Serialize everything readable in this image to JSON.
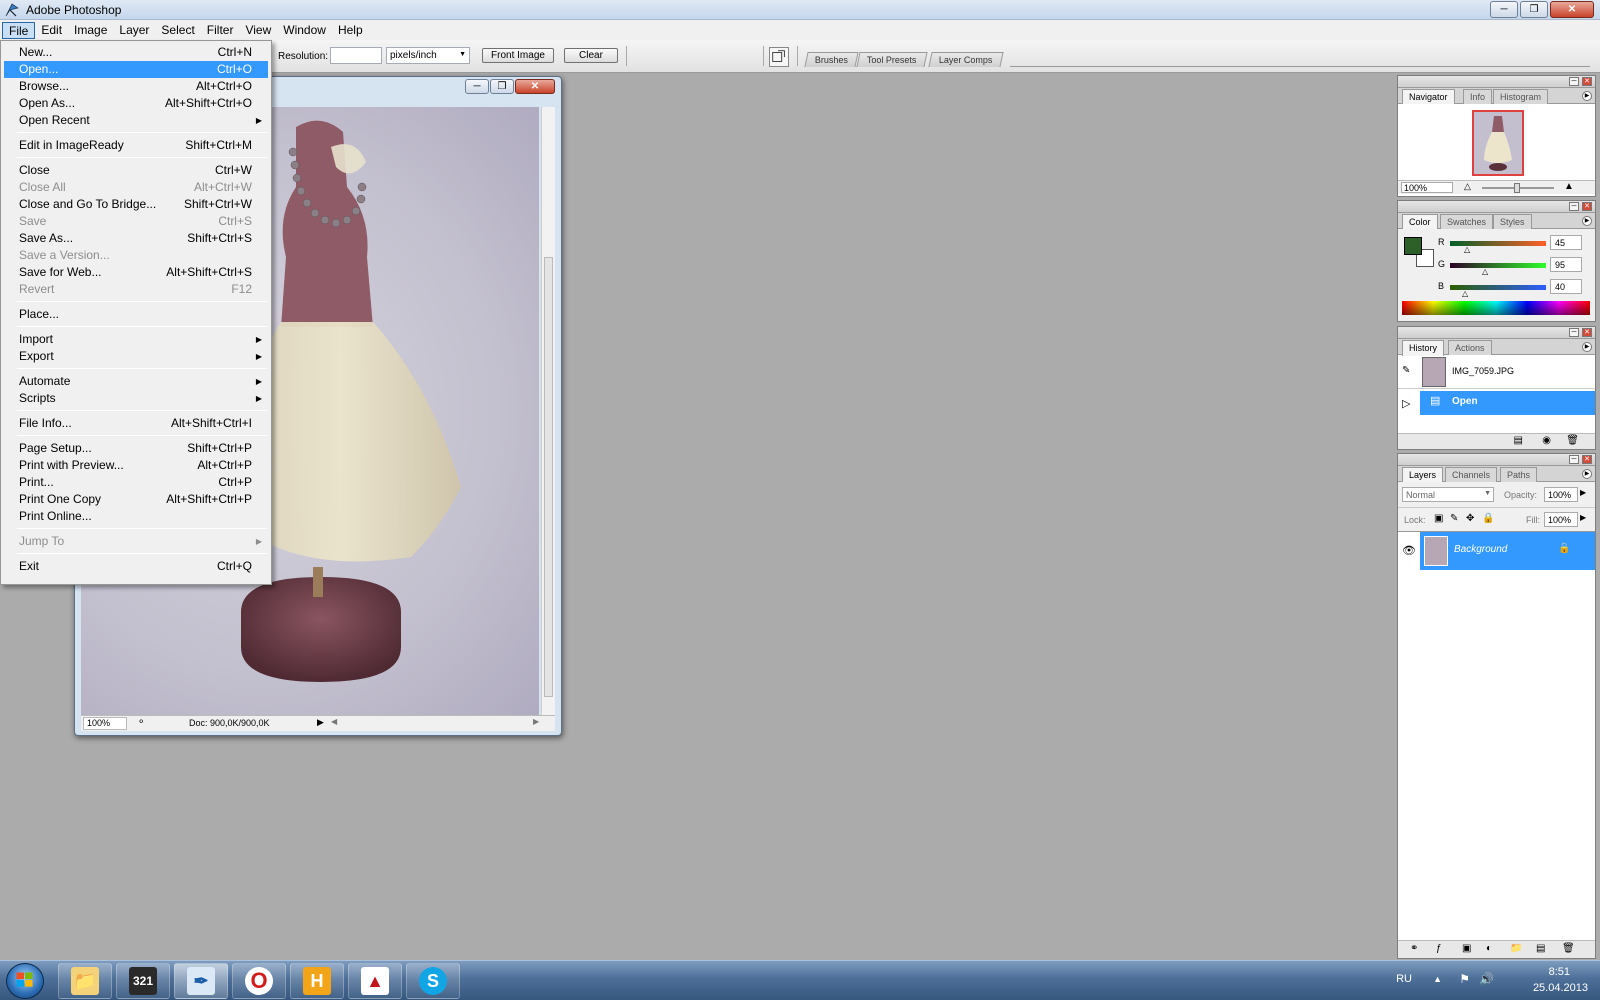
{
  "app": {
    "title": "Adobe Photoshop"
  },
  "menubar": [
    "File",
    "Edit",
    "Image",
    "Layer",
    "Select",
    "Filter",
    "View",
    "Window",
    "Help"
  ],
  "options_bar": {
    "resolution_label": "Resolution:",
    "resolution_value": "",
    "units": "pixels/inch",
    "front_image": "Front Image",
    "clear": "Clear",
    "well_tabs": [
      "Brushes",
      "Tool Presets",
      "Layer Comps"
    ]
  },
  "file_menu": {
    "items": [
      {
        "label": "New...",
        "shortcut": "Ctrl+N"
      },
      {
        "label": "Open...",
        "shortcut": "Ctrl+O"
      },
      {
        "label": "Browse...",
        "shortcut": "Alt+Ctrl+O"
      },
      {
        "label": "Open As...",
        "shortcut": "Alt+Shift+Ctrl+O"
      },
      {
        "label": "Open Recent",
        "shortcut": ""
      },
      {
        "label": "Edit in ImageReady",
        "shortcut": "Shift+Ctrl+M"
      },
      {
        "label": "Close",
        "shortcut": "Ctrl+W"
      },
      {
        "label": "Close All",
        "shortcut": "Alt+Ctrl+W"
      },
      {
        "label": "Close and Go To Bridge...",
        "shortcut": "Shift+Ctrl+W"
      },
      {
        "label": "Save",
        "shortcut": "Ctrl+S"
      },
      {
        "label": "Save As...",
        "shortcut": "Shift+Ctrl+S"
      },
      {
        "label": "Save a Version...",
        "shortcut": ""
      },
      {
        "label": "Save for Web...",
        "shortcut": "Alt+Shift+Ctrl+S"
      },
      {
        "label": "Revert",
        "shortcut": "F12"
      },
      {
        "label": "Place...",
        "shortcut": ""
      },
      {
        "label": "Import",
        "shortcut": ""
      },
      {
        "label": "Export",
        "shortcut": ""
      },
      {
        "label": "Automate",
        "shortcut": ""
      },
      {
        "label": "Scripts",
        "shortcut": ""
      },
      {
        "label": "File Info...",
        "shortcut": "Alt+Shift+Ctrl+I"
      },
      {
        "label": "Page Setup...",
        "shortcut": "Shift+Ctrl+P"
      },
      {
        "label": "Print with Preview...",
        "shortcut": "Alt+Ctrl+P"
      },
      {
        "label": "Print...",
        "shortcut": "Ctrl+P"
      },
      {
        "label": "Print One Copy",
        "shortcut": "Alt+Shift+Ctrl+P"
      },
      {
        "label": "Print Online...",
        "shortcut": ""
      },
      {
        "label": "Jump To",
        "shortcut": ""
      },
      {
        "label": "Exit",
        "shortcut": "Ctrl+Q"
      }
    ]
  },
  "document": {
    "zoom": "100%",
    "doc_info": "Doc: 900,0K/900,0K"
  },
  "navigator": {
    "tabs": [
      "Navigator",
      "Info",
      "Histogram"
    ],
    "zoom": "100%"
  },
  "color_panel": {
    "tabs": [
      "Color",
      "Swatches",
      "Styles"
    ],
    "r_label": "R",
    "g_label": "G",
    "b_label": "B",
    "r": "45",
    "g": "95",
    "b": "40",
    "foreground": "#2d5f28"
  },
  "history_panel": {
    "tabs": [
      "History",
      "Actions"
    ],
    "snapshot": "IMG_7059.JPG",
    "state": "Open"
  },
  "layers_panel": {
    "tabs": [
      "Layers",
      "Channels",
      "Paths"
    ],
    "blend_mode": "Normal",
    "opacity_label": "Opacity:",
    "opacity": "100%",
    "lock_label": "Lock:",
    "fill_label": "Fill:",
    "fill": "100%",
    "layer_name": "Background"
  },
  "taskbar": {
    "lang": "RU",
    "time": "8:51",
    "date": "25.04.2013"
  },
  "colors": {
    "selection": "#3399ff",
    "workspace": "#ababab"
  }
}
